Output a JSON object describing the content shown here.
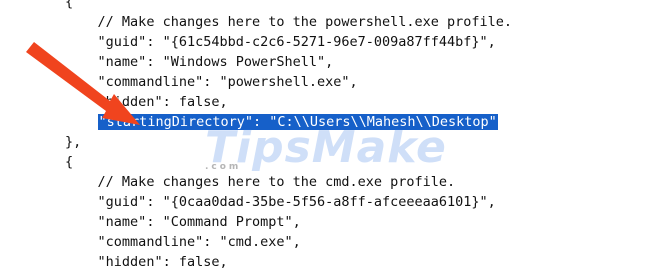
{
  "editor": {
    "lines": [
      {
        "indent": "        ",
        "text": "{"
      },
      {
        "indent": "            ",
        "text": "// Make changes here to the powershell.exe profile."
      },
      {
        "indent": "            ",
        "text": "\"guid\": \"{61c54bbd-c2c6-5271-96e7-009a87ff44bf}\","
      },
      {
        "indent": "            ",
        "text": "\"name\": \"Windows PowerShell\","
      },
      {
        "indent": "            ",
        "text": "\"commandline\": \"powershell.exe\","
      },
      {
        "indent": "            ",
        "text": "\"hidden\": false,"
      },
      {
        "indent": "            ",
        "text": "\"startingDirectory\": \"C:\\\\Users\\\\Mahesh\\\\Desktop\"",
        "selected": true
      },
      {
        "indent": "        ",
        "text": "},"
      },
      {
        "indent": "        ",
        "text": "{"
      },
      {
        "indent": "            ",
        "text": "// Make changes here to the cmd.exe profile."
      },
      {
        "indent": "            ",
        "text": "\"guid\": \"{0caa0dad-35be-5f56-a8ff-afceeeaa6101}\","
      },
      {
        "indent": "            ",
        "text": "\"name\": \"Command Prompt\","
      },
      {
        "indent": "            ",
        "text": "\"commandline\": \"cmd.exe\","
      },
      {
        "indent": "            ",
        "text": "\"hidden\": false,"
      }
    ]
  },
  "watermark": {
    "text": "TipsMake",
    "subtext": ".com"
  },
  "colors": {
    "selection": "#1660c9",
    "arrow": "#f0441e",
    "text": "#111111"
  },
  "icons": {
    "pointer": "red-arrow-icon"
  }
}
